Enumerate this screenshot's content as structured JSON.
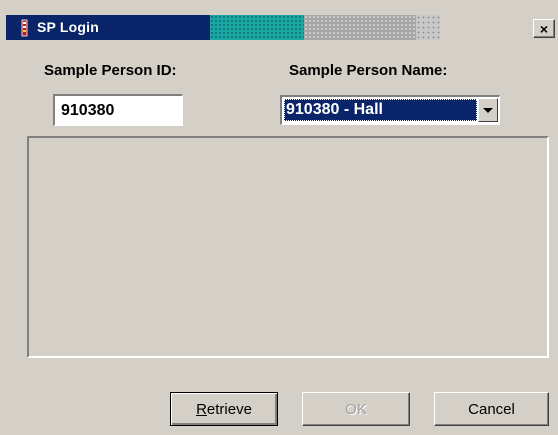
{
  "window": {
    "title": "SP Login",
    "icon": "app-icon",
    "close_label": "×"
  },
  "form": {
    "id_label": "Sample Person ID:",
    "name_label": "Sample Person Name:",
    "id_value": "910380",
    "name_selected": "910380 - Hall"
  },
  "buttons": {
    "retrieve_mnemonic": "R",
    "retrieve_rest": "etrieve",
    "ok": "OK",
    "cancel": "Cancel"
  },
  "colors": {
    "titlebar": "#0a246a",
    "window_bg": "#d4d0c8",
    "selection": "#0a246a"
  }
}
